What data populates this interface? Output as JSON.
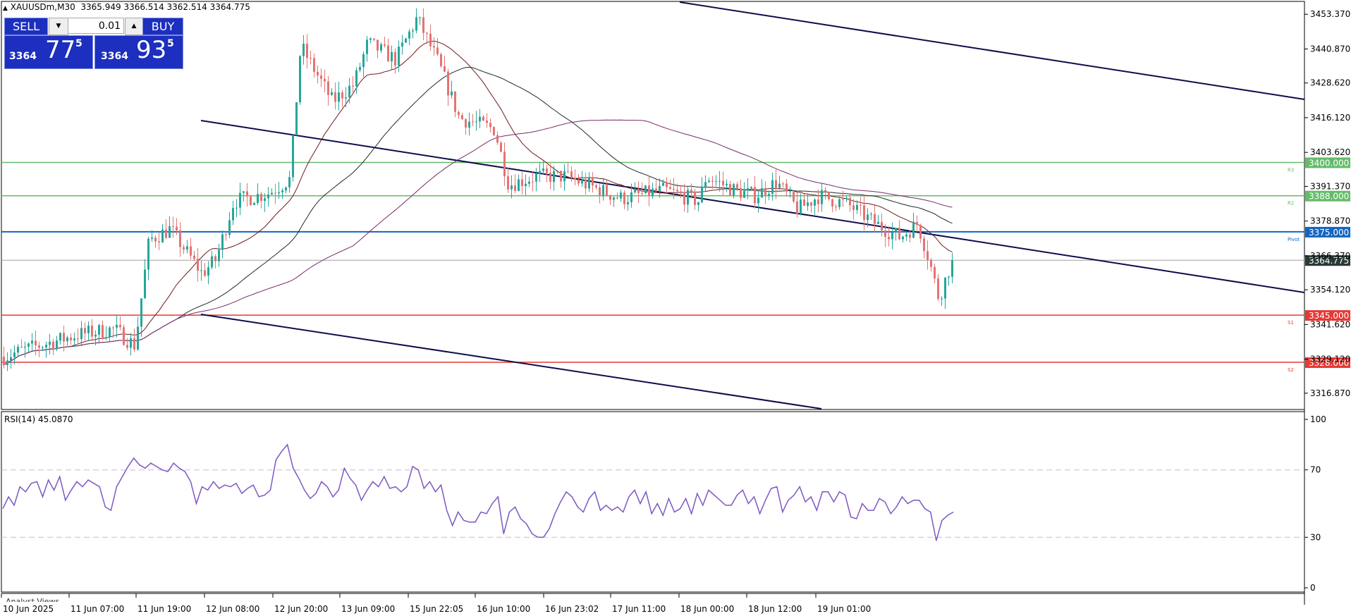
{
  "header": {
    "symbol_line": "XAUUSDm,M30",
    "ohlc": "3365.949 3366.514 3362.514 3364.775"
  },
  "trade_panel": {
    "sell_label": "SELL",
    "buy_label": "BUY",
    "lot_value": "0.01",
    "sell_price_prefix": "3364",
    "sell_price_main": "77",
    "sell_price_sup": "5",
    "buy_price_prefix": "3364",
    "buy_price_main": "93",
    "buy_price_sup": "5"
  },
  "colors": {
    "bull": "#26a69a",
    "bear": "#e57373",
    "resistance": "#66bb6a",
    "pivot": "#1565c0",
    "support": "#e53935",
    "channel": "#0d0d4d",
    "rsi": "#7e57c2",
    "ma1": "#6d1a1a",
    "ma2": "#1b2a2a",
    "ma3": "#7a2a6a"
  },
  "price_axis": {
    "ticks": [
      "3453.370",
      "3440.870",
      "3428.620",
      "3416.120",
      "3403.620",
      "3391.370",
      "3378.870",
      "3366.370",
      "3354.120",
      "3341.620",
      "3329.120",
      "3316.870"
    ],
    "min": 3311.0,
    "max": 3458.0
  },
  "levels": [
    {
      "label": "3400.000",
      "tag": "R3",
      "value": 3400.0,
      "kind": "resistance"
    },
    {
      "label": "3388.000",
      "tag": "R2",
      "value": 3388.0,
      "kind": "resistance"
    },
    {
      "label": "3375.000",
      "tag": "Pivot",
      "value": 3375.0,
      "kind": "pivot"
    },
    {
      "label": "3345.000",
      "tag": "S1",
      "value": 3345.0,
      "kind": "support"
    },
    {
      "label": "3328.000",
      "tag": "S2",
      "value": 3328.0,
      "kind": "support"
    }
  ],
  "current_price": {
    "label": "3364.775",
    "value": 3364.775
  },
  "rsi": {
    "title": "RSI(14) 45.0870",
    "ticks": [
      "100",
      "70",
      "30",
      "0"
    ],
    "levels": [
      70,
      30
    ],
    "series": [
      47,
      54,
      49,
      60,
      57,
      62,
      63,
      54,
      64,
      58,
      66,
      52,
      58,
      63,
      60,
      64,
      62,
      60,
      48,
      46,
      60,
      66,
      72,
      77,
      73,
      71,
      74,
      72,
      70,
      69,
      74,
      71,
      69,
      63,
      50,
      60,
      58,
      63,
      59,
      61,
      60,
      62,
      56,
      59,
      61,
      54,
      55,
      58,
      76,
      81,
      85,
      71,
      65,
      58,
      53,
      56,
      63,
      60,
      54,
      58,
      71,
      65,
      61,
      52,
      58,
      63,
      60,
      66,
      59,
      60,
      57,
      60,
      72,
      70,
      59,
      63,
      57,
      61,
      46,
      37,
      45,
      40,
      39,
      39,
      45,
      44,
      50,
      54,
      32,
      45,
      48,
      41,
      38,
      32,
      30,
      30,
      35,
      44,
      51,
      57,
      54,
      48,
      45,
      53,
      57,
      46,
      49,
      46,
      48,
      45,
      54,
      58,
      50,
      57,
      44,
      50,
      43,
      53,
      45,
      47,
      53,
      44,
      56,
      49,
      58,
      55,
      52,
      49,
      49,
      55,
      58,
      50,
      54,
      44,
      52,
      59,
      60,
      45,
      52,
      55,
      60,
      51,
      54,
      46,
      57,
      57,
      51,
      57,
      55,
      42,
      41,
      50,
      46,
      46,
      53,
      51,
      44,
      48,
      54,
      50,
      52,
      52,
      47,
      45,
      28,
      40,
      43,
      45
    ]
  },
  "time_axis": {
    "labels": [
      "10 Jun 2025",
      "11 Jun 07:00",
      "11 Jun 19:00",
      "12 Jun 08:00",
      "12 Jun 20:00",
      "13 Jun 09:00",
      "15 Jun 22:05",
      "16 Jun 10:00",
      "16 Jun 23:02",
      "17 Jun 11:00",
      "18 Jun 00:00",
      "18 Jun 12:00",
      "19 Jun 01:00"
    ]
  },
  "bottom_tab": "Analyst Views"
}
